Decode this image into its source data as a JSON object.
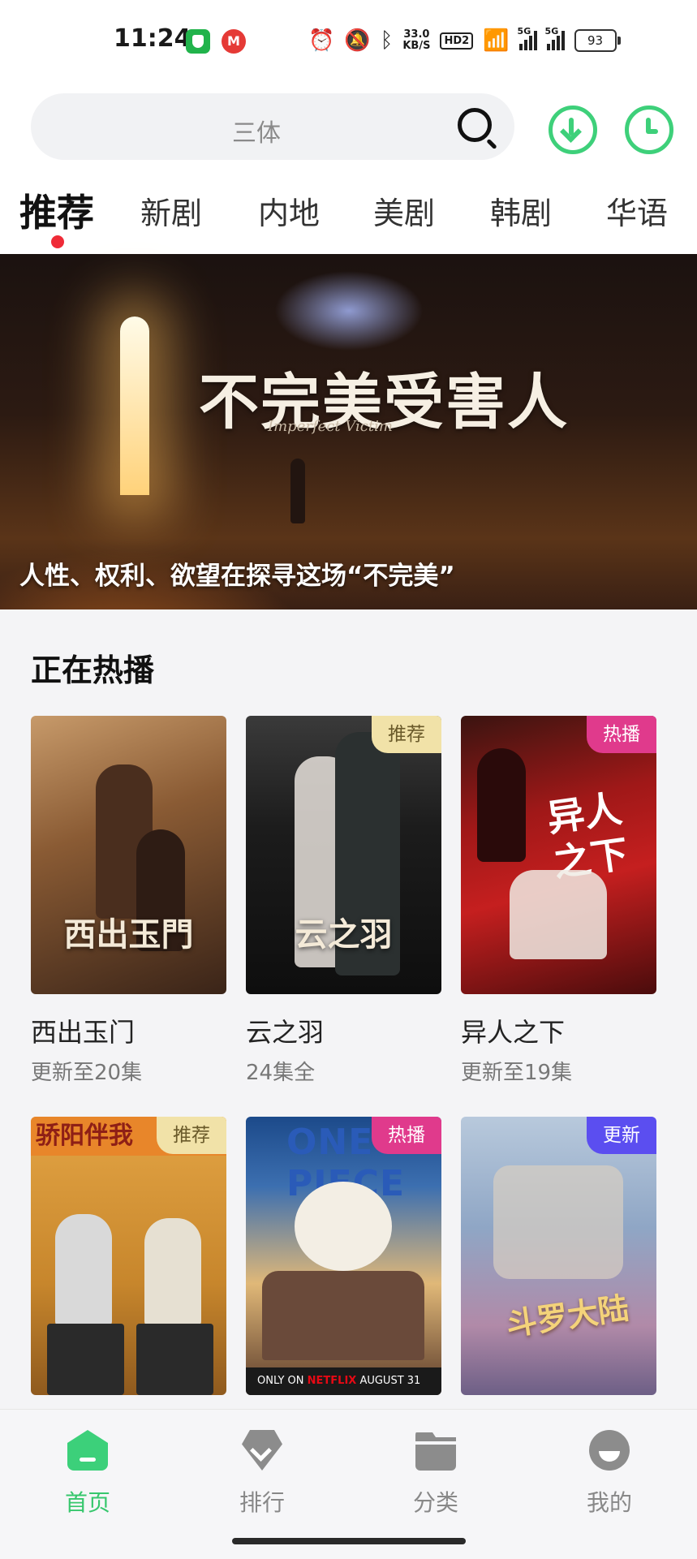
{
  "status_bar": {
    "time": "11:24",
    "app2_glyph": "M",
    "net_speed_value": "33.0",
    "net_speed_unit": "KB/S",
    "hd_label": "HD2",
    "sim1_label": "5G",
    "sim2_label": "5G",
    "battery": "93"
  },
  "search": {
    "placeholder": "三体"
  },
  "tabs": [
    {
      "label": "推荐",
      "active": true
    },
    {
      "label": "新剧"
    },
    {
      "label": "内地"
    },
    {
      "label": "美剧"
    },
    {
      "label": "韩剧"
    },
    {
      "label": "华语"
    }
  ],
  "banner": {
    "title": "不完美受害人",
    "subtitle": "Imperfect Victim",
    "caption": "人性、权利、欲望在探寻这场“不完美”"
  },
  "section": {
    "title": "正在热播",
    "cards": [
      {
        "title": "西出玉门",
        "subtitle": "更新至20集",
        "badge": "",
        "poster_text": "西出玉門"
      },
      {
        "title": "云之羽",
        "subtitle": "24集全",
        "badge": "推荐",
        "poster_text": "云之羽"
      },
      {
        "title": "异人之下",
        "subtitle": "更新至19集",
        "badge": "热播",
        "poster_text": "异人之下"
      },
      {
        "title": "",
        "subtitle": "",
        "badge": "推荐",
        "poster_text": "骄阳伴我"
      },
      {
        "title": "",
        "subtitle": "",
        "badge": "热播",
        "poster_text": "ONE PIECE",
        "poster_footer_pre": "ONLY ON",
        "poster_footer_brand": "NETFLIX",
        "poster_footer_date": "AUGUST 31"
      },
      {
        "title": "",
        "subtitle": "",
        "badge": "更新",
        "poster_text": "斗罗大陆"
      }
    ]
  },
  "bottom_nav": [
    {
      "label": "首页",
      "icon": "home-icon",
      "active": true
    },
    {
      "label": "排行",
      "icon": "rank-icon"
    },
    {
      "label": "分类",
      "icon": "folder-icon"
    },
    {
      "label": "我的",
      "icon": "profile-icon"
    }
  ],
  "colors": {
    "accent_green": "#37c76d",
    "tab_indicator": "#ef2b37",
    "badge_recommend": "#f1e2a8",
    "badge_hot": "#e03a8c",
    "badge_update": "#5b4ef0"
  }
}
